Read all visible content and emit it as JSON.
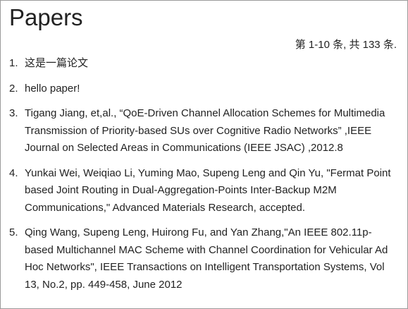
{
  "page": {
    "title": "Papers",
    "pager_text": "第 1-10 条, 共 133 条."
  },
  "papers": [
    {
      "num": "1.",
      "text": "这是一篇论文"
    },
    {
      "num": "2.",
      "text": "hello paper!"
    },
    {
      "num": "3.",
      "text": "Tigang Jiang, et,al., “QoE-Driven Channel Allocation Schemes for Multimedia Transmission of Priority-based SUs over Cognitive Radio Networks” ,IEEE Journal on Selected Areas in Communications (IEEE JSAC) ,2012.8"
    },
    {
      "num": "4.",
      "text": "Yunkai Wei, Weiqiao Li, Yuming Mao, Supeng Leng and Qin Yu, \"Fermat Point based Joint Routing in Dual-Aggregation-Points Inter-Backup M2M Communications,\" Advanced Materials Research, accepted."
    },
    {
      "num": "5.",
      "text": "Qing Wang, Supeng Leng, Huirong Fu, and Yan Zhang,\"An IEEE 802.11p-based Multichannel MAC Scheme with Channel Coordination for Vehicular Ad Hoc Networks\", IEEE Transactions on Intelligent Transportation Systems, Vol 13, No.2, pp. 449-458, June 2012"
    }
  ]
}
